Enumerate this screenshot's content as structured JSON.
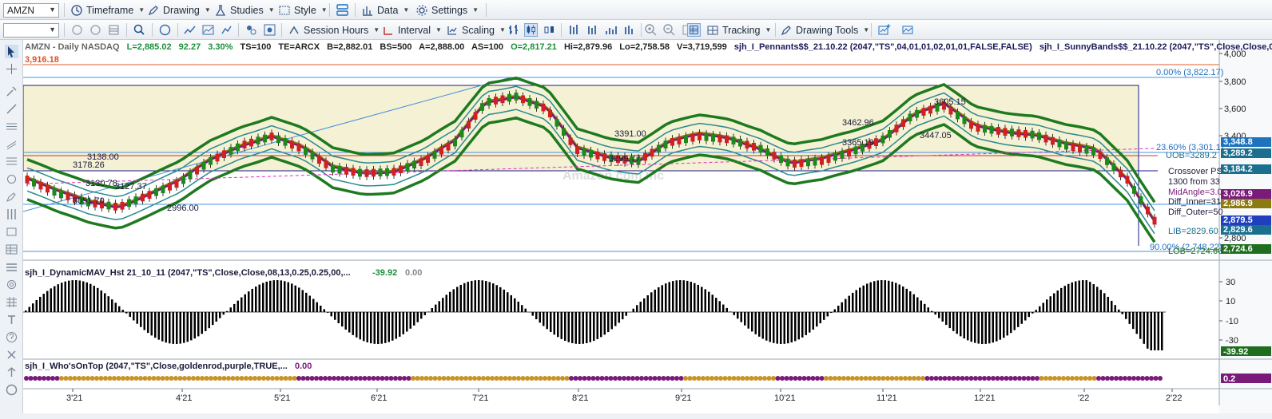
{
  "toolbar1": {
    "symbol": "AMZN",
    "items": [
      {
        "label": "Timeframe",
        "icon": "timeframe-icon"
      },
      {
        "label": "Drawing",
        "icon": "pencil-icon"
      },
      {
        "label": "Studies",
        "icon": "flask-icon"
      },
      {
        "label": "Style",
        "icon": "style-icon"
      },
      {
        "label": "Data",
        "icon": "data-icon"
      },
      {
        "label": "Settings",
        "icon": "gear-icon"
      }
    ]
  },
  "toolbar2": {
    "items": [
      {
        "label": "Session Hours",
        "icon": "session-hours-icon"
      },
      {
        "label": "Interval",
        "icon": "interval-icon"
      },
      {
        "label": "Scaling",
        "icon": "scaling-icon"
      },
      {
        "label": "Tracking",
        "icon": "tracking-icon"
      },
      {
        "label": "Drawing Tools",
        "icon": "drawing-tools-icon"
      }
    ]
  },
  "header": {
    "symbol_line": "AMZN - Daily  NASDAQ",
    "last": "L=2,885.02",
    "change": "92.27",
    "pct": "3.30%",
    "ts": "TS=100",
    "te": "TE=ARCX",
    "bid": "B=2,882.01",
    "bs": "BS=500",
    "ask": "A=2,888.00",
    "as": "AS=100",
    "open": "O=2,817.21",
    "hi": "Hi=2,879.96",
    "lo": "Lo=2,758.58",
    "vol": "V=3,719,599",
    "study1": "sjh_I_Pennants$$_21.10.22 (2047,\"TS\",04,01,01,02,01,01,FALSE,FALSE)",
    "study2": "sjh_I_SunnyBands$$_21.10.22 (2047,\"TS\",Close,Close,01...",
    "top_level": "3,916.18",
    "watermark": "Amazon.com Inc"
  },
  "price_axis": {
    "ticks": [
      "4,000",
      "3,800",
      "3,600",
      "3,400",
      "3,200",
      "3,000",
      "2,800"
    ],
    "badges": [
      {
        "text": "3,348.8",
        "color": "#1e73be"
      },
      {
        "text": "3,289.2",
        "color": "#1a6f8e"
      },
      {
        "text": "3,184.2",
        "color": "#1a6f8e"
      },
      {
        "text": "3,026.9",
        "color": "#7a1a7a"
      },
      {
        "text": "2,986.9",
        "color": "#8a7a10"
      },
      {
        "text": "2,879.5",
        "color": "#1f3fbf"
      },
      {
        "text": "2,829.6",
        "color": "#1a6f8e"
      },
      {
        "text": "2,724.6",
        "color": "#1f6e1f"
      }
    ]
  },
  "annotations": {
    "fib_top": "0.00% (3,822.17)",
    "fib_mid": "23.60% (3,301.1)",
    "fib_low": "90.00% (2,748.22)",
    "uob": "UOB=3289.2",
    "crossover": "Crossover PS",
    "from": "1300 from 33",
    "mid_angle": "MidAngle=3.0",
    "diff_inner": "Diff_Inner=31",
    "diff_outer": "Diff_Outer=50",
    "lib": "LIB=2829.60",
    "lob": "LOB=2724.60",
    "points": [
      "3178.26",
      "3130.78",
      "3051.70",
      "2996.00",
      "3138.00",
      "3127.37",
      "3391.00",
      "3299.77",
      "3462.96",
      "3365.19",
      "3605.15",
      "3447.05"
    ]
  },
  "histogram": {
    "title": "sjh_I_DynamicMAV_Hst 21_10_11 (2047,\"TS\",Close,Close,08,13,0.25,0.25,00,...",
    "value1": "-39.92",
    "value2": "0.00",
    "ticks": [
      "30",
      "10",
      "-10",
      "-30"
    ],
    "badge": "-39.92"
  },
  "whosontop": {
    "title": "sjh_I_Who'sOnTop (2047,\"TS\",Close,goldenrod,purple,TRUE,...",
    "value": "0.00",
    "badge": "0.2"
  },
  "xaxis": {
    "labels": [
      "3'21",
      "4'21",
      "5'21",
      "6'21",
      "7'21",
      "8'21",
      "9'21",
      "10'21",
      "11'21",
      "12'21",
      "'22",
      "2'22"
    ]
  },
  "chart_data": {
    "type": "candlestick",
    "ylim": [
      2700,
      4000
    ],
    "yticks": [
      4000,
      3800,
      3600,
      3400,
      3200,
      3000,
      2800
    ],
    "months": [
      "3'21",
      "4'21",
      "5'21",
      "6'21",
      "7'21",
      "8'21",
      "9'21",
      "10'21",
      "11'21",
      "12'21",
      "'22",
      "2'22"
    ],
    "close_approx": [
      3180,
      3090,
      3030,
      3000,
      3080,
      3160,
      3300,
      3400,
      3460,
      3380,
      3250,
      3220,
      3230,
      3300,
      3420,
      3680,
      3720,
      3640,
      3370,
      3320,
      3300,
      3420,
      3460,
      3440,
      3380,
      3280,
      3300,
      3360,
      3440,
      3600,
      3660,
      3520,
      3490,
      3470,
      3400,
      3360,
      3180,
      2880
    ]
  }
}
